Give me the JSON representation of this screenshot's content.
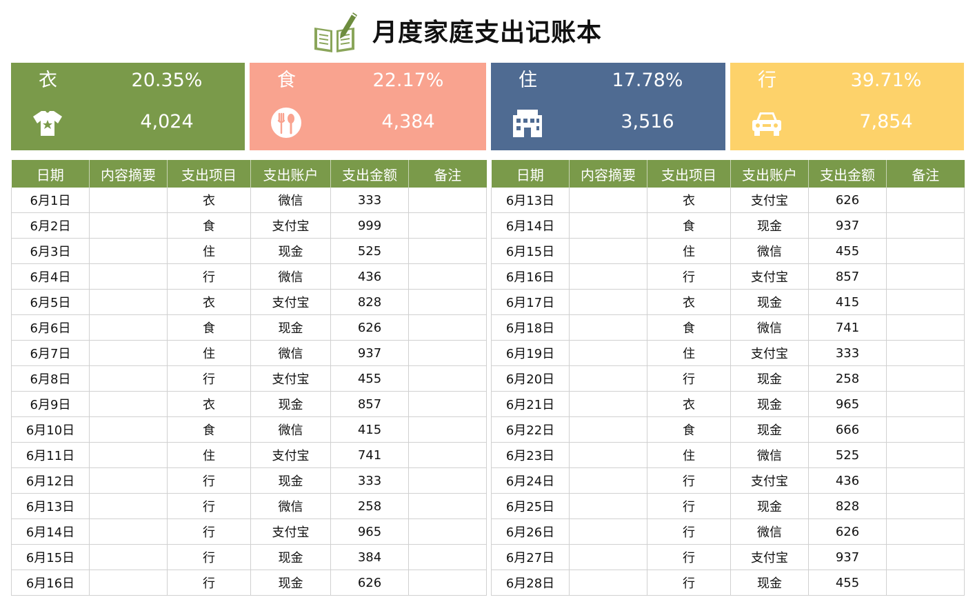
{
  "title": "月度家庭支出记账本",
  "cards": [
    {
      "cat": "衣",
      "pct": "20.35%",
      "amount": "4,024",
      "icon": "shirt-icon",
      "color": "#7a9a4a"
    },
    {
      "cat": "食",
      "pct": "22.17%",
      "amount": "4,384",
      "icon": "food-icon",
      "color": "#f9a38f"
    },
    {
      "cat": "住",
      "pct": "17.78%",
      "amount": "3,516",
      "icon": "building-icon",
      "color": "#4f6b92"
    },
    {
      "cat": "行",
      "pct": "39.71%",
      "amount": "7,854",
      "icon": "car-icon",
      "color": "#fdd26a"
    }
  ],
  "columns": [
    "日期",
    "内容摘要",
    "支出项目",
    "支出账户",
    "支出金额",
    "备注"
  ],
  "left_rows": [
    [
      "6月1日",
      "",
      "衣",
      "微信",
      "333",
      ""
    ],
    [
      "6月2日",
      "",
      "食",
      "支付宝",
      "999",
      ""
    ],
    [
      "6月3日",
      "",
      "住",
      "现金",
      "525",
      ""
    ],
    [
      "6月4日",
      "",
      "行",
      "微信",
      "436",
      ""
    ],
    [
      "6月5日",
      "",
      "衣",
      "支付宝",
      "828",
      ""
    ],
    [
      "6月6日",
      "",
      "食",
      "现金",
      "626",
      ""
    ],
    [
      "6月7日",
      "",
      "住",
      "微信",
      "937",
      ""
    ],
    [
      "6月8日",
      "",
      "行",
      "支付宝",
      "455",
      ""
    ],
    [
      "6月9日",
      "",
      "衣",
      "现金",
      "857",
      ""
    ],
    [
      "6月10日",
      "",
      "食",
      "微信",
      "415",
      ""
    ],
    [
      "6月11日",
      "",
      "住",
      "支付宝",
      "741",
      ""
    ],
    [
      "6月12日",
      "",
      "行",
      "现金",
      "333",
      ""
    ],
    [
      "6月13日",
      "",
      "行",
      "微信",
      "258",
      ""
    ],
    [
      "6月14日",
      "",
      "行",
      "支付宝",
      "965",
      ""
    ],
    [
      "6月15日",
      "",
      "行",
      "现金",
      "384",
      ""
    ],
    [
      "6月16日",
      "",
      "行",
      "现金",
      "626",
      ""
    ]
  ],
  "right_rows": [
    [
      "6月13日",
      "",
      "衣",
      "支付宝",
      "626",
      ""
    ],
    [
      "6月14日",
      "",
      "食",
      "现金",
      "937",
      ""
    ],
    [
      "6月15日",
      "",
      "住",
      "微信",
      "455",
      ""
    ],
    [
      "6月16日",
      "",
      "行",
      "支付宝",
      "857",
      ""
    ],
    [
      "6月17日",
      "",
      "衣",
      "现金",
      "415",
      ""
    ],
    [
      "6月18日",
      "",
      "食",
      "微信",
      "741",
      ""
    ],
    [
      "6月19日",
      "",
      "住",
      "支付宝",
      "333",
      ""
    ],
    [
      "6月20日",
      "",
      "行",
      "现金",
      "258",
      ""
    ],
    [
      "6月21日",
      "",
      "衣",
      "现金",
      "965",
      ""
    ],
    [
      "6月22日",
      "",
      "食",
      "现金",
      "666",
      ""
    ],
    [
      "6月23日",
      "",
      "住",
      "微信",
      "525",
      ""
    ],
    [
      "6月24日",
      "",
      "行",
      "支付宝",
      "436",
      ""
    ],
    [
      "6月25日",
      "",
      "行",
      "现金",
      "828",
      ""
    ],
    [
      "6月26日",
      "",
      "行",
      "微信",
      "626",
      ""
    ],
    [
      "6月27日",
      "",
      "行",
      "支付宝",
      "937",
      ""
    ],
    [
      "6月28日",
      "",
      "行",
      "现金",
      "455",
      ""
    ]
  ]
}
